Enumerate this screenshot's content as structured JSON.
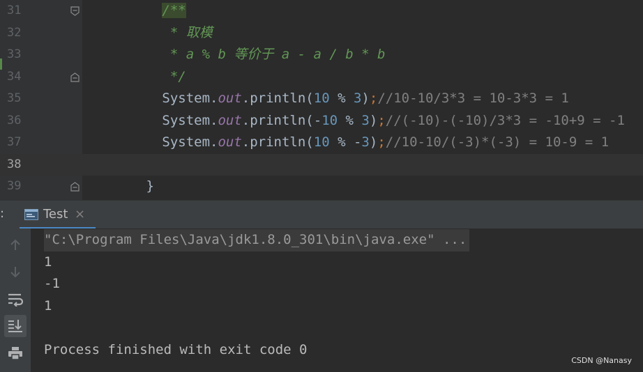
{
  "editor": {
    "lines": [
      {
        "number": "31",
        "fold": "open",
        "indent": "          ",
        "tokens": [
          {
            "t": "/**",
            "c": "t-doc-hl"
          }
        ]
      },
      {
        "number": "32",
        "fold": "",
        "indent": "           ",
        "tokens": [
          {
            "t": "* 取模",
            "c": "t-doc"
          }
        ]
      },
      {
        "number": "33",
        "fold": "",
        "indent": "           ",
        "tokens": [
          {
            "t": "* a % b 等价于 a - a / b * b",
            "c": "t-doc"
          }
        ]
      },
      {
        "number": "34",
        "fold": "close",
        "indent": "           ",
        "tokens": [
          {
            "t": "*/",
            "c": "t-doc"
          }
        ]
      },
      {
        "number": "35",
        "fold": "",
        "indent": "          ",
        "tokens": [
          {
            "t": "System.",
            "c": "t-plain"
          },
          {
            "t": "out",
            "c": "t-field"
          },
          {
            "t": ".println(",
            "c": "t-plain"
          },
          {
            "t": "10",
            "c": "t-num"
          },
          {
            "t": " % ",
            "c": "t-plain"
          },
          {
            "t": "3",
            "c": "t-num"
          },
          {
            "t": ")",
            "c": "t-plain"
          },
          {
            "t": ";",
            "c": "t-semi"
          },
          {
            "t": "//10-10/3*3 = 10-3*3 = 1",
            "c": "t-comment"
          }
        ]
      },
      {
        "number": "36",
        "fold": "",
        "indent": "          ",
        "tokens": [
          {
            "t": "System.",
            "c": "t-plain"
          },
          {
            "t": "out",
            "c": "t-field"
          },
          {
            "t": ".println(-",
            "c": "t-plain"
          },
          {
            "t": "10",
            "c": "t-num"
          },
          {
            "t": " % ",
            "c": "t-plain"
          },
          {
            "t": "3",
            "c": "t-num"
          },
          {
            "t": ")",
            "c": "t-plain"
          },
          {
            "t": ";",
            "c": "t-semi"
          },
          {
            "t": "//(-10)-(-10)/3*3 = -10+9 = -1",
            "c": "t-comment"
          }
        ]
      },
      {
        "number": "37",
        "fold": "",
        "indent": "          ",
        "tokens": [
          {
            "t": "System.",
            "c": "t-plain"
          },
          {
            "t": "out",
            "c": "t-field"
          },
          {
            "t": ".println(",
            "c": "t-plain"
          },
          {
            "t": "10",
            "c": "t-num"
          },
          {
            "t": " % -",
            "c": "t-plain"
          },
          {
            "t": "3",
            "c": "t-num"
          },
          {
            "t": ")",
            "c": "t-plain"
          },
          {
            "t": ";",
            "c": "t-semi"
          },
          {
            "t": "//10-10/(-3)*(-3) = 10-9 = 1",
            "c": "t-comment"
          }
        ]
      },
      {
        "number": "38",
        "fold": "",
        "indent": "",
        "current": true,
        "tokens": []
      },
      {
        "number": "39",
        "fold": "close",
        "indent": "        ",
        "tokens": [
          {
            "t": "}",
            "c": "t-plain"
          }
        ]
      }
    ]
  },
  "run_window": {
    "label_prefix": ":",
    "tab": {
      "label": "Test",
      "close": "×",
      "icon": "console-icon"
    }
  },
  "toolbar": {
    "buttons": [
      {
        "name": "up-arrow-icon",
        "active": false
      },
      {
        "name": "down-arrow-icon",
        "active": false
      },
      {
        "name": "soft-wrap-icon",
        "active": false
      },
      {
        "name": "scroll-to-end-icon",
        "active": true
      },
      {
        "name": "print-icon",
        "active": false
      }
    ]
  },
  "console": {
    "command": "\"C:\\Program Files\\Java\\jdk1.8.0_301\\bin\\java.exe\" ...",
    "output": [
      "1",
      "-1",
      "1",
      ""
    ],
    "exit_message": "Process finished with exit code 0"
  },
  "watermark": "CSDN @Nanasy",
  "colors": {
    "background": "#2b2b2b",
    "gutter": "#313335",
    "panel": "#3c3f41",
    "keyword": "#cc7832",
    "number": "#6897bb",
    "field": "#9876aa",
    "doc_comment": "#629755",
    "comment": "#808080",
    "accent": "#4a88c7"
  }
}
